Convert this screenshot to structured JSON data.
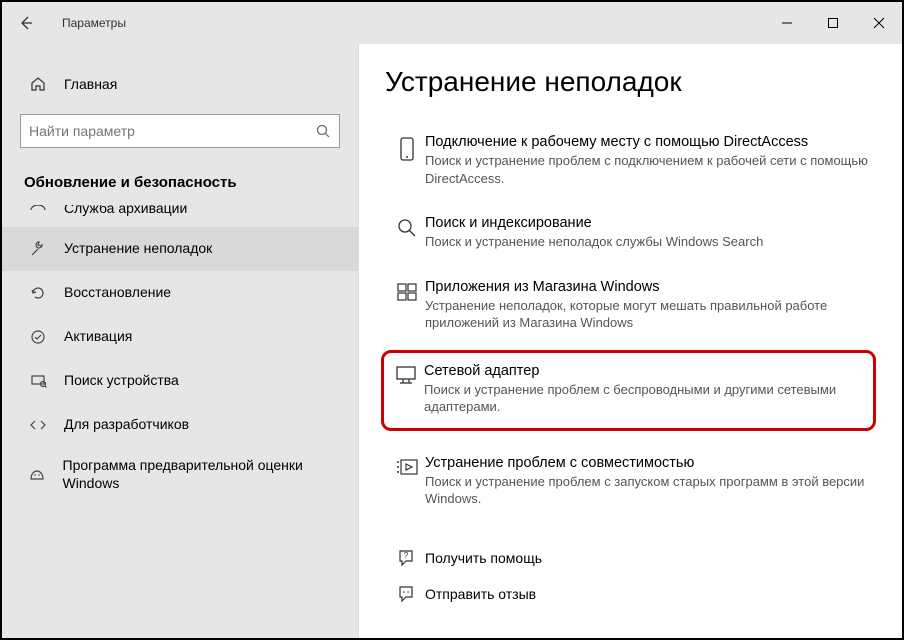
{
  "window": {
    "title": "Параметры"
  },
  "sidebar": {
    "home_label": "Главная",
    "search_placeholder": "Найти параметр",
    "section_header": "Обновление и безопасность",
    "items": [
      {
        "label": "Служба архивации"
      },
      {
        "label": "Устранение неполадок"
      },
      {
        "label": "Восстановление"
      },
      {
        "label": "Активация"
      },
      {
        "label": "Поиск устройства"
      },
      {
        "label": "Для разработчиков"
      },
      {
        "label": "Программа предварительной оценки Windows"
      }
    ]
  },
  "content": {
    "title": "Устранение неполадок",
    "items": [
      {
        "title": "Подключение к рабочему месту с помощью DirectAccess",
        "desc": "Поиск и устранение проблем с подключением к рабочей сети с помощью DirectAccess."
      },
      {
        "title": "Поиск и индексирование",
        "desc": "Поиск и устранение неполадок службы Windows Search"
      },
      {
        "title": "Приложения из Магазина Windows",
        "desc": "Устранение неполадок, которые могут мешать правильной работе приложений из Магазина Windows"
      },
      {
        "title": "Сетевой адаптер",
        "desc": "Поиск и устранение проблем с беспроводными и другими сетевыми адаптерами."
      },
      {
        "title": "Устранение проблем с совместимостью",
        "desc": "Поиск и устранение проблем с запуском старых программ в этой версии Windows."
      }
    ],
    "help": {
      "get_help": "Получить помощь",
      "feedback": "Отправить отзыв"
    }
  }
}
